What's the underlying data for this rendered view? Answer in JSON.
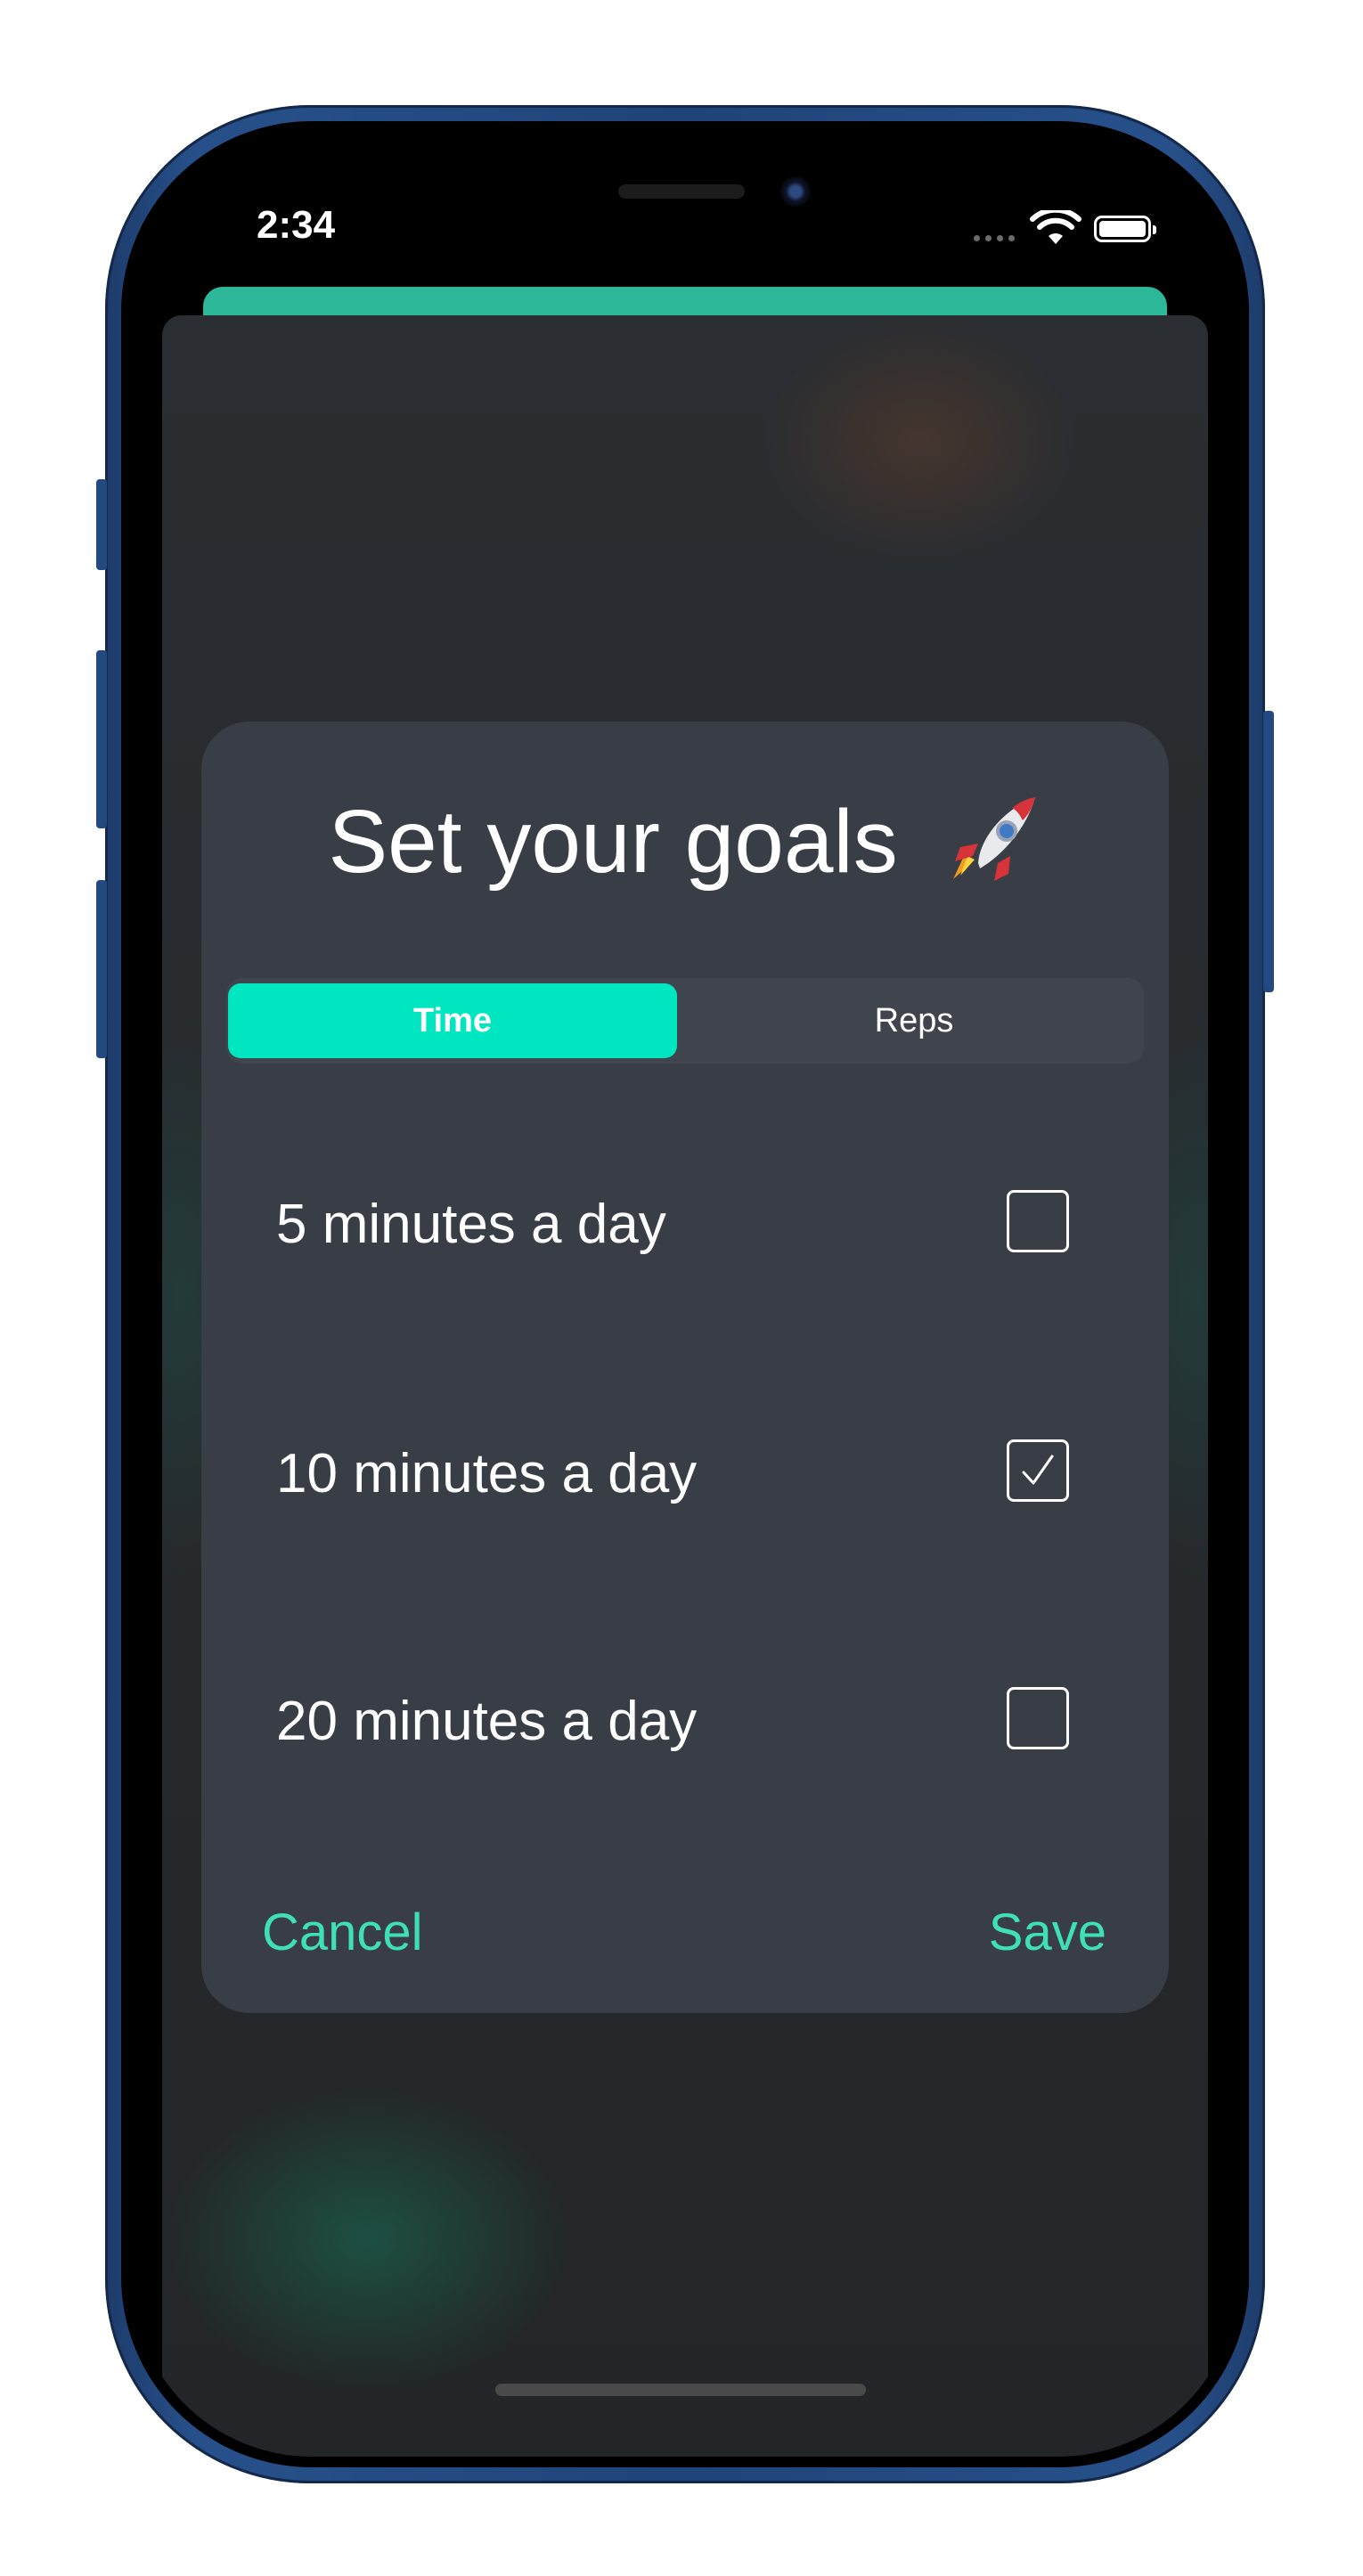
{
  "status_bar": {
    "time": "2:34"
  },
  "dialog": {
    "title": "Set your goals",
    "title_icon": "rocket-emoji",
    "tabs": [
      {
        "label": "Time",
        "active": true
      },
      {
        "label": "Reps",
        "active": false
      }
    ],
    "options": [
      {
        "label": "5 minutes a day",
        "checked": false
      },
      {
        "label": "10 minutes a day",
        "checked": true
      },
      {
        "label": "20 minutes a day",
        "checked": false
      }
    ],
    "cancel_label": "Cancel",
    "save_label": "Save"
  },
  "colors": {
    "accent": "#00e6c0",
    "action_text": "#3fe0b6",
    "dialog_bg": "#393d45",
    "device_frame": "#1f4479"
  }
}
